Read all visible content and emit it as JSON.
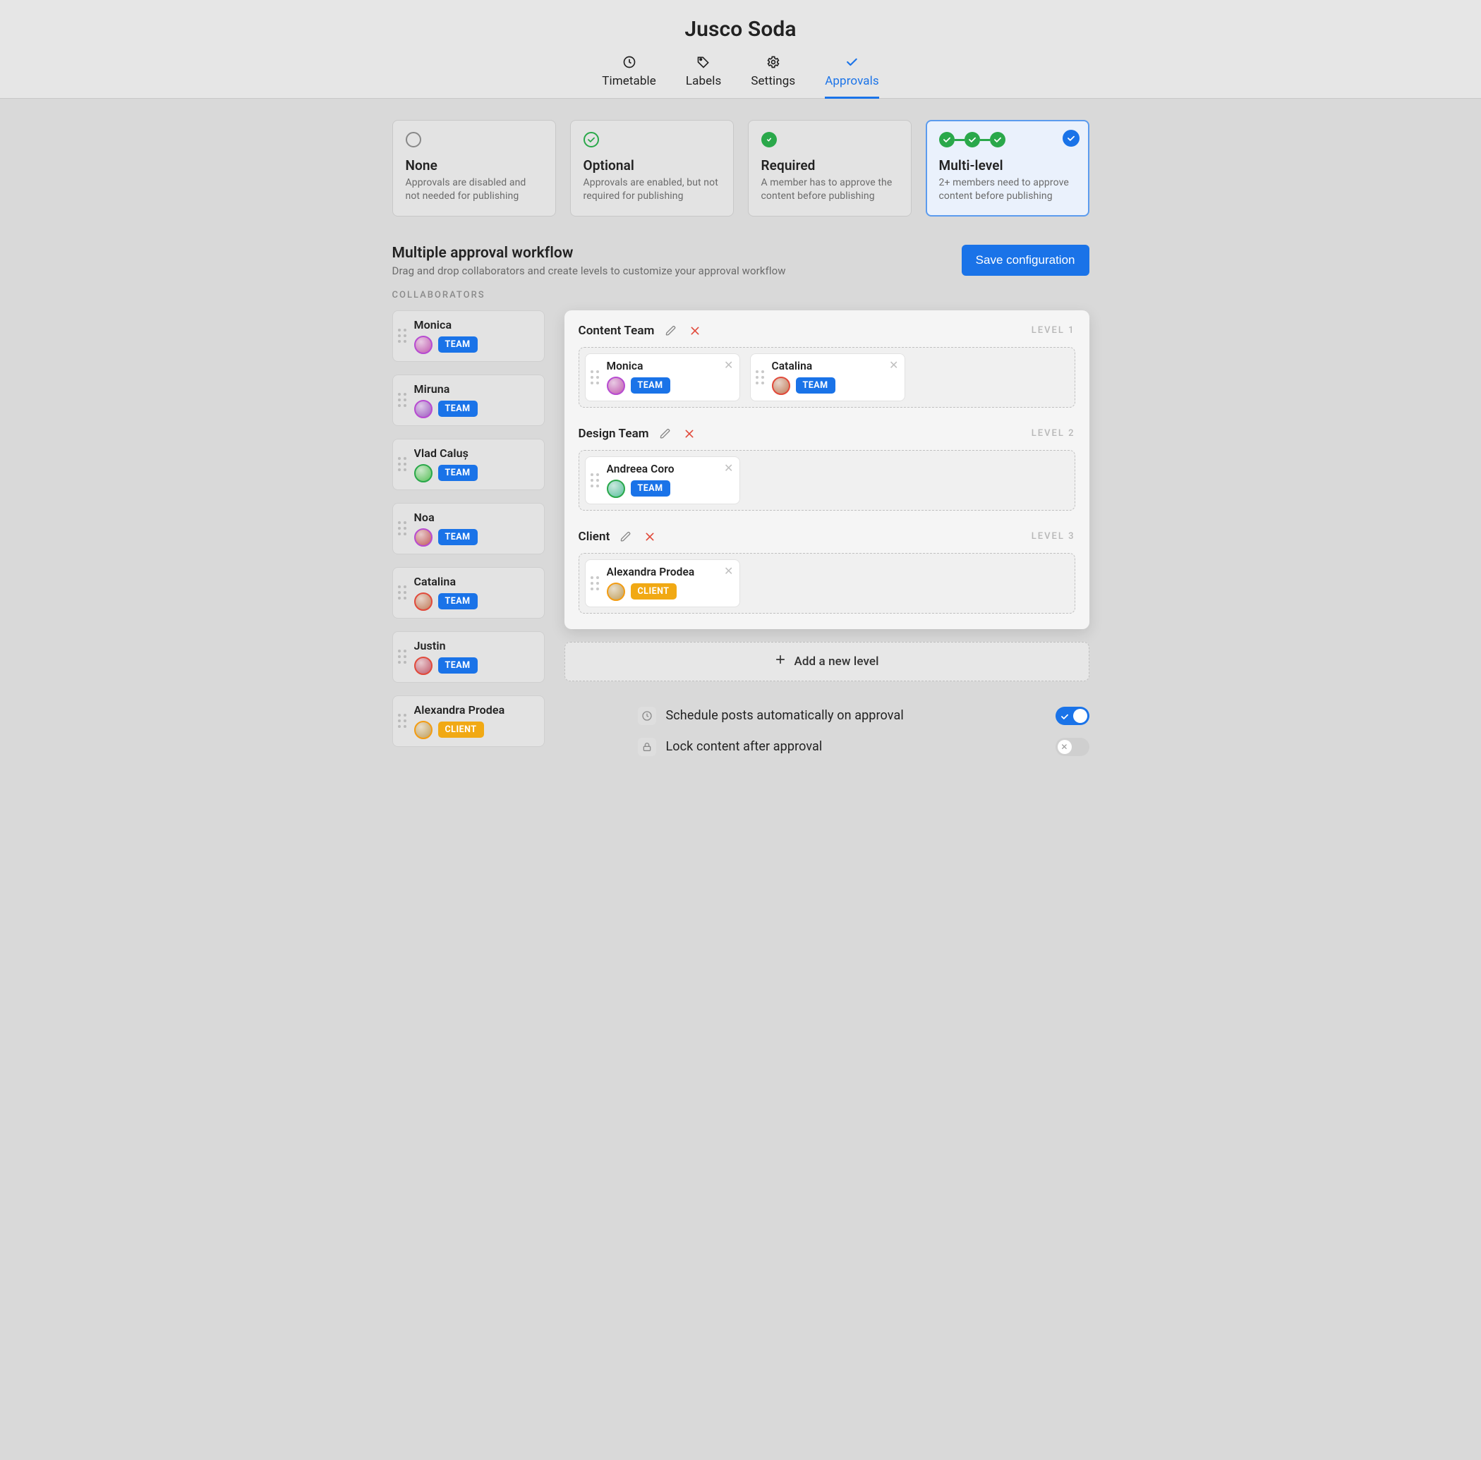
{
  "header": {
    "title": "Jusco Soda",
    "tabs": [
      {
        "label": "Timetable",
        "icon": "clock-icon",
        "active": false
      },
      {
        "label": "Labels",
        "icon": "tag-icon",
        "active": false
      },
      {
        "label": "Settings",
        "icon": "gear-icon",
        "active": false
      },
      {
        "label": "Approvals",
        "icon": "check-icon",
        "active": true
      }
    ]
  },
  "approval_modes": [
    {
      "key": "none",
      "title": "None",
      "desc": "Approvals are disabled and not needed for publishing"
    },
    {
      "key": "optional",
      "title": "Optional",
      "desc": "Approvals are enabled, but not required for publishing"
    },
    {
      "key": "required",
      "title": "Required",
      "desc": "A member has to approve the content before publishing"
    },
    {
      "key": "multi",
      "title": "Multi-level",
      "desc": "2+ members need to approve content before publishing",
      "selected": true
    }
  ],
  "workflow": {
    "heading": "Multiple approval workflow",
    "sub": "Drag and drop collaborators and create levels to customize your approval workflow",
    "save_label": "Save configuration",
    "collab_label": "COLLABORATORS",
    "add_level_label": "Add a new level"
  },
  "collaborators": [
    {
      "name": "Monica",
      "role": "TEAM",
      "ring": "purple",
      "hue": 310
    },
    {
      "name": "Miruna",
      "role": "TEAM",
      "ring": "purple",
      "hue": 280
    },
    {
      "name": "Vlad Caluș",
      "role": "TEAM",
      "ring": "green",
      "hue": 120
    },
    {
      "name": "Noa",
      "role": "TEAM",
      "ring": "purple",
      "hue": 0
    },
    {
      "name": "Catalina",
      "role": "TEAM",
      "ring": "red",
      "hue": 20
    },
    {
      "name": "Justin",
      "role": "TEAM",
      "ring": "red",
      "hue": 350
    },
    {
      "name": "Alexandra Prodea",
      "role": "CLIENT",
      "ring": "orange",
      "hue": 40
    }
  ],
  "levels": [
    {
      "title": "Content Team",
      "tag": "LEVEL 1",
      "members": [
        {
          "name": "Monica",
          "role": "TEAM",
          "ring": "purple",
          "hue": 310
        },
        {
          "name": "Catalina",
          "role": "TEAM",
          "ring": "red",
          "hue": 20
        }
      ]
    },
    {
      "title": "Design Team",
      "tag": "LEVEL 2",
      "members": [
        {
          "name": "Andreea Coro",
          "role": "TEAM",
          "ring": "green",
          "hue": 160
        }
      ]
    },
    {
      "title": "Client",
      "tag": "LEVEL 3",
      "members": [
        {
          "name": "Alexandra Prodea",
          "role": "CLIENT",
          "ring": "orange",
          "hue": 40
        }
      ]
    }
  ],
  "settings": {
    "schedule": {
      "label": "Schedule posts automatically on approval",
      "on": true
    },
    "lock": {
      "label": "Lock content after approval",
      "on": false
    }
  }
}
